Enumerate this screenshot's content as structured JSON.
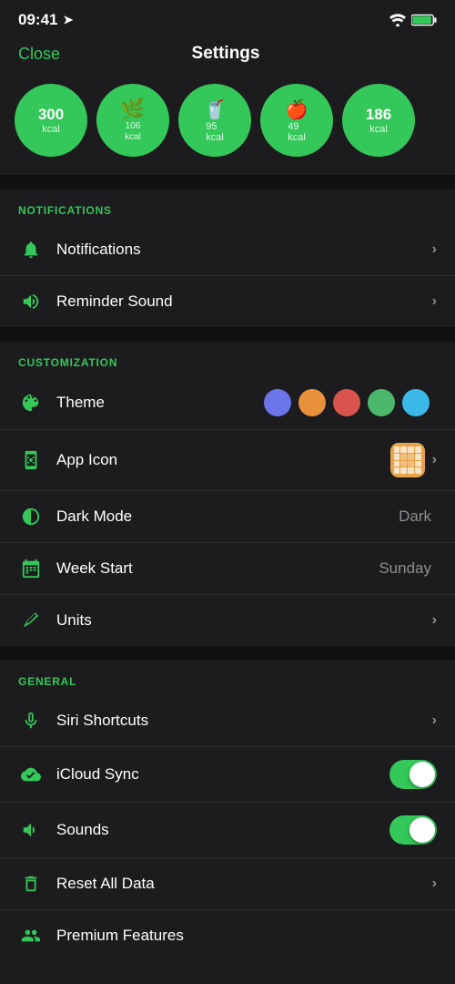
{
  "statusBar": {
    "time": "09:41",
    "locationIcon": "➤"
  },
  "header": {
    "closeLabel": "Close",
    "title": "Settings"
  },
  "circles": [
    {
      "value": "300",
      "unit": "kcal",
      "type": "number"
    },
    {
      "value": "",
      "unit": "106\nkcal",
      "type": "icon",
      "icon": "🌿"
    },
    {
      "value": "95",
      "unit": "kcal",
      "type": "number"
    },
    {
      "value": "49",
      "unit": "kcal",
      "type": "number"
    },
    {
      "value": "186",
      "unit": "kcal",
      "type": "number"
    }
  ],
  "sections": {
    "notifications": {
      "header": "NOTIFICATIONS",
      "items": [
        {
          "id": "notifications",
          "label": "Notifications",
          "type": "chevron"
        },
        {
          "id": "reminder-sound",
          "label": "Reminder Sound",
          "type": "chevron"
        }
      ]
    },
    "customization": {
      "header": "CUSTOMIZATION",
      "items": [
        {
          "id": "theme",
          "label": "Theme",
          "type": "colors"
        },
        {
          "id": "app-icon",
          "label": "App Icon",
          "type": "icon-thumb"
        },
        {
          "id": "dark-mode",
          "label": "Dark Mode",
          "value": "Dark",
          "type": "value"
        },
        {
          "id": "week-start",
          "label": "Week Start",
          "value": "Sunday",
          "type": "value"
        },
        {
          "id": "units",
          "label": "Units",
          "type": "chevron"
        }
      ],
      "themeColors": [
        "#6b74e8",
        "#e8913a",
        "#d9534f",
        "#4cb86b",
        "#3ab8e8"
      ]
    },
    "general": {
      "header": "GENERAL",
      "items": [
        {
          "id": "siri-shortcuts",
          "label": "Siri Shortcuts",
          "type": "chevron"
        },
        {
          "id": "icloud-sync",
          "label": "iCloud Sync",
          "type": "toggle",
          "on": true
        },
        {
          "id": "sounds",
          "label": "Sounds",
          "type": "toggle",
          "on": true
        },
        {
          "id": "reset-all-data",
          "label": "Reset All Data",
          "type": "chevron"
        },
        {
          "id": "premium-features",
          "label": "Premium Features",
          "type": "chevron"
        }
      ]
    }
  }
}
